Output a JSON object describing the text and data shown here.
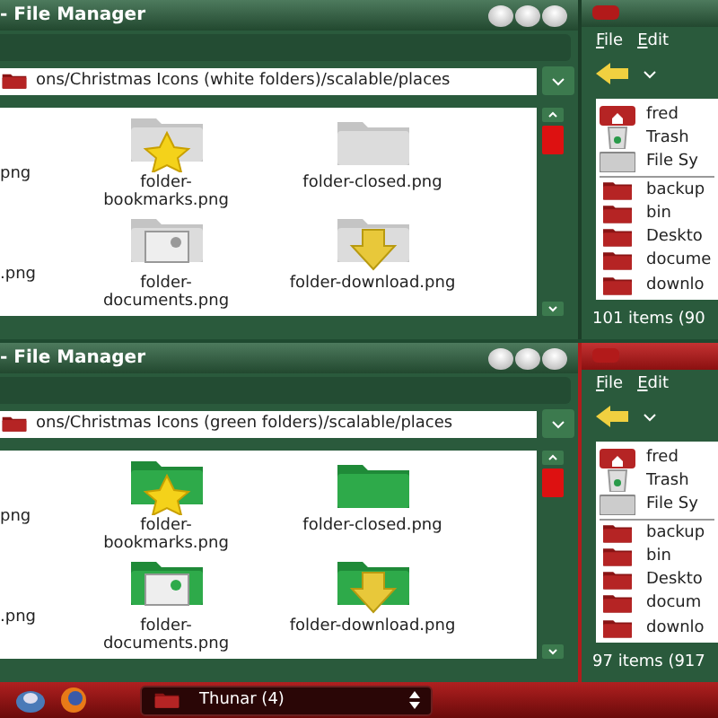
{
  "file_managers": [
    {
      "title": "- File Manager",
      "path": "ons/Christmas Icons (white folders)/scalable/places",
      "kind": "white",
      "files": [
        {
          "name": "png",
          "kind": "none"
        },
        {
          "name": "folder-bookmarks.png",
          "kind": "star"
        },
        {
          "name": "folder-closed.png",
          "kind": "plain"
        },
        {
          "name": ".png",
          "kind": "none"
        },
        {
          "name": "folder-documents.png",
          "kind": "documents"
        },
        {
          "name": "folder-download.png",
          "kind": "download"
        }
      ]
    },
    {
      "title": "- File Manager",
      "path": "ons/Christmas Icons (green folders)/scalable/places",
      "kind": "green",
      "files": [
        {
          "name": "png",
          "kind": "none"
        },
        {
          "name": "folder-bookmarks.png",
          "kind": "star"
        },
        {
          "name": "folder-closed.png",
          "kind": "plain"
        },
        {
          "name": ".png",
          "kind": "none"
        },
        {
          "name": "folder-documents.png",
          "kind": "documents"
        },
        {
          "name": "folder-download.png",
          "kind": "download"
        }
      ]
    }
  ],
  "side_windows": [
    {
      "active": false,
      "menu": [
        "File",
        "Edit"
      ],
      "places": [
        {
          "name": "fred",
          "kind": "home"
        },
        {
          "name": "Trash",
          "kind": "trash"
        },
        {
          "name": "File Sy",
          "kind": "drive"
        }
      ],
      "folders": [
        "backup",
        "bin",
        "Deskto",
        "docume",
        "downlo"
      ],
      "status": "101 items (90"
    },
    {
      "active": true,
      "menu": [
        "File",
        "Edit"
      ],
      "places": [
        {
          "name": "fred",
          "kind": "home"
        },
        {
          "name": "Trash",
          "kind": "trash"
        },
        {
          "name": "File Sy",
          "kind": "drive"
        }
      ],
      "folders": [
        "backup",
        "bin",
        "Deskto",
        "docum",
        "downlo"
      ],
      "status": "97 items (917"
    }
  ],
  "taskbar": {
    "task": "Thunar (4)"
  }
}
